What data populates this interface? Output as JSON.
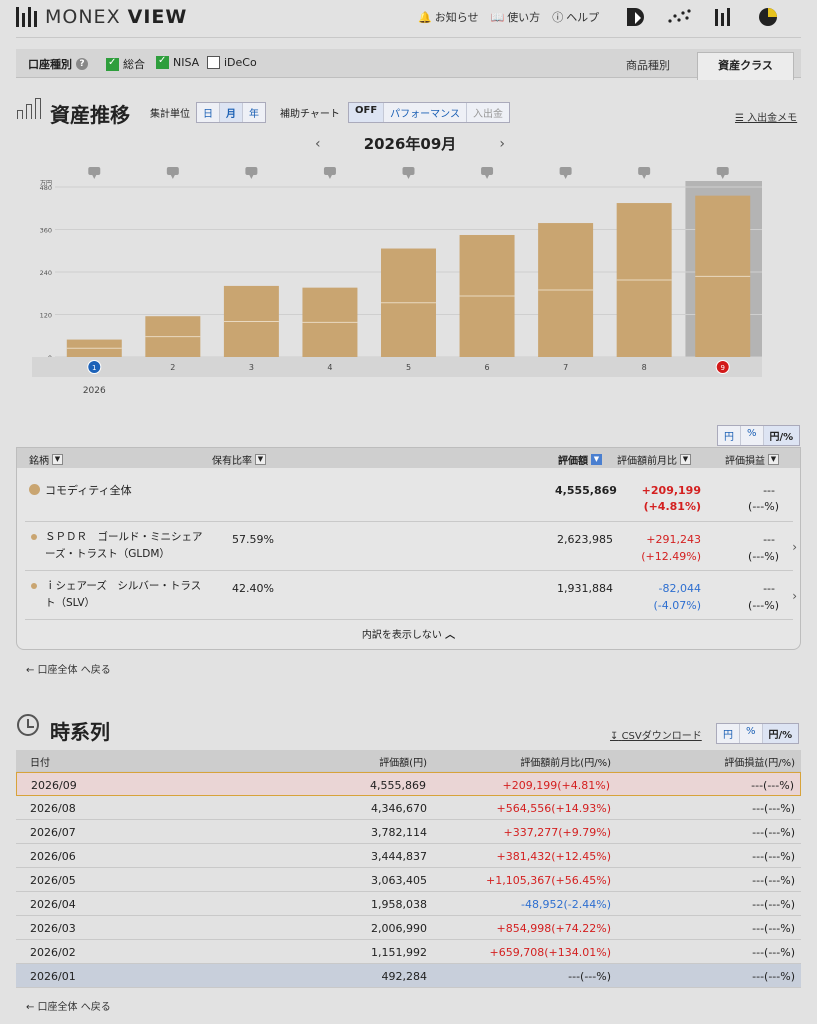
{
  "header": {
    "brand_left": "MONEX",
    "brand_right": "VIEW",
    "nav": [
      {
        "icon": "bell-icon",
        "label": "お知らせ"
      },
      {
        "icon": "book-icon",
        "label": "使い方"
      },
      {
        "icon": "help-icon",
        "label": "ヘルプ"
      }
    ]
  },
  "account_bar": {
    "label": "口座種別",
    "checks": [
      {
        "label": "総合",
        "checked": true
      },
      {
        "label": "NISA",
        "checked": true
      },
      {
        "label": "iDeCo",
        "checked": false
      }
    ],
    "tabs": [
      "商品種別",
      "資産クラス"
    ],
    "active_tab": "資産クラス"
  },
  "trend": {
    "title": "資産推移",
    "unit_label": "集計単位",
    "unit_options": [
      "日",
      "月",
      "年"
    ],
    "unit_selected": "月",
    "aux_label": "補助チャート",
    "aux_options": [
      "OFF",
      "パフォーマンス",
      "入出金"
    ],
    "aux_selected": "OFF",
    "memo_link": "入出金メモ",
    "month": "2026年09月",
    "prev_arrow": "‹",
    "next_arrow": "›"
  },
  "chart_data": {
    "type": "bar",
    "y_unit": "万円",
    "ylim": [
      0,
      480
    ],
    "yticks": [
      0,
      120,
      240,
      360,
      480
    ],
    "categories": [
      "1",
      "2",
      "3",
      "4",
      "5",
      "6",
      "7",
      "8",
      "9"
    ],
    "values": [
      49.2,
      115.2,
      200.7,
      195.8,
      306.3,
      344.5,
      378.2,
      434.7,
      455.6
    ],
    "year_label": "2026",
    "selected": "9",
    "bar_color": "#c9a571"
  },
  "summary_units": [
    "円",
    "%",
    "円/%"
  ],
  "holdings": {
    "headers": {
      "name": "銘柄",
      "ratio": "保有比率",
      "value": "評価額",
      "change": "評価額前月比",
      "pnl": "評価損益"
    },
    "total": {
      "name": "コモディティ全体",
      "value": "4,555,869",
      "change": "+209,199",
      "change_pct": "(+4.81%)",
      "pnl": "---",
      "pnl_pct": "(---%)"
    },
    "items": [
      {
        "name_line1": "ＳＰＤＲ　ゴールド・ミニシェア",
        "name_line2": "ーズ・トラスト（GLDM）",
        "ratio": "57.59%",
        "value": "2,623,985",
        "change": "+291,243",
        "change_pct": "(+12.49%)",
        "pnl": "---",
        "pnl_pct": "(---%)"
      },
      {
        "name_line1": "ｉシェアーズ　シルバー・トラス",
        "name_line2": "ト（SLV）",
        "ratio": "42.40%",
        "value": "1,931,884",
        "change": "-82,044",
        "change_pct": "(-4.07%)",
        "pnl": "---",
        "pnl_pct": "(---%)"
      }
    ],
    "breakdown_toggle": "内訳を表示しない"
  },
  "back_link": "← 口座全体 へ戻る",
  "timeseries": {
    "title": "時系列",
    "csv_link": "CSVダウンロード",
    "units": [
      "円",
      "%",
      "円/%"
    ],
    "headers": [
      "日付",
      "評価額(円)",
      "評価額前月比(円/%)",
      "評価損益(円/%)"
    ],
    "rows": [
      {
        "date": "2026/09",
        "value": "4,555,869",
        "change": "+209,199(+4.81%)",
        "pnl": "---(---%)"
      },
      {
        "date": "2026/08",
        "value": "4,346,670",
        "change": "+564,556(+14.93%)",
        "pnl": "---(---%)"
      },
      {
        "date": "2026/07",
        "value": "3,782,114",
        "change": "+337,277(+9.79%)",
        "pnl": "---(---%)"
      },
      {
        "date": "2026/06",
        "value": "3,444,837",
        "change": "+381,432(+12.45%)",
        "pnl": "---(---%)"
      },
      {
        "date": "2026/05",
        "value": "3,063,405",
        "change": "+1,105,367(+56.45%)",
        "pnl": "---(---%)"
      },
      {
        "date": "2026/04",
        "value": "1,958,038",
        "change": "-48,952(-2.44%)",
        "pnl": "---(---%)"
      },
      {
        "date": "2026/03",
        "value": "2,006,990",
        "change": "+854,998(+74.22%)",
        "pnl": "---(---%)"
      },
      {
        "date": "2026/02",
        "value": "1,151,992",
        "change": "+659,708(+134.01%)",
        "pnl": "---(---%)"
      },
      {
        "date": "2026/01",
        "value": "492,284",
        "change": "---(---%)",
        "pnl": "---(---%)"
      }
    ]
  }
}
